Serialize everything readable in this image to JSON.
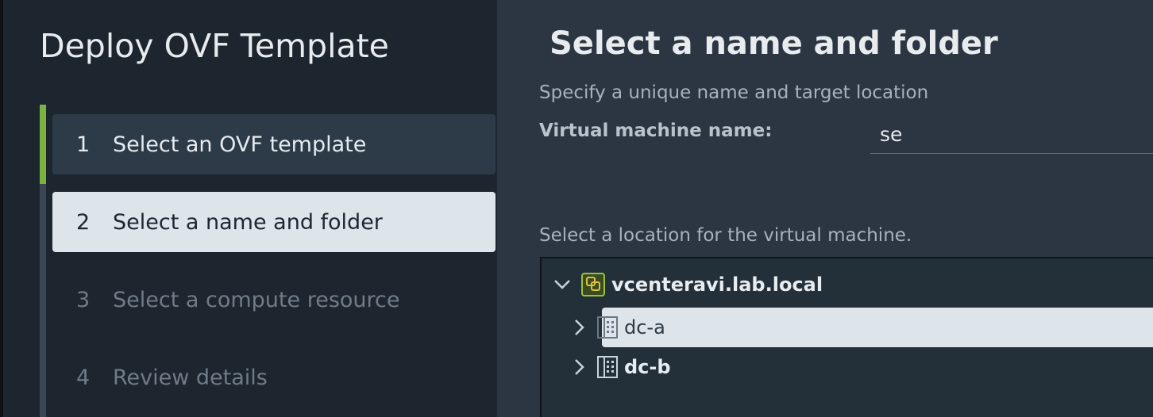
{
  "wizard": {
    "title": "Deploy OVF Template",
    "steps": [
      {
        "number": "1",
        "label": "Select an OVF template",
        "state": "completed"
      },
      {
        "number": "2",
        "label": "Select a name and folder",
        "state": "current"
      },
      {
        "number": "3",
        "label": "Select a compute resource",
        "state": "future"
      },
      {
        "number": "4",
        "label": "Review details",
        "state": "future"
      }
    ],
    "accent_color": "#7bb341"
  },
  "page": {
    "title": "Select a name and folder",
    "subtitle": "Specify a unique name and target location",
    "vm_name_label": "Virtual machine name:",
    "vm_name_value": "se",
    "location_label": "Select a location for the virtual machine."
  },
  "tree": {
    "root": {
      "label": "vcenteravi.lab.local",
      "icon": "vcenter-icon",
      "expanded": true
    },
    "children": [
      {
        "label": "dc-a",
        "icon": "datacenter-icon",
        "selected": true,
        "expanded": false
      },
      {
        "label": "dc-b",
        "icon": "datacenter-icon",
        "selected": false,
        "expanded": false
      }
    ]
  }
}
